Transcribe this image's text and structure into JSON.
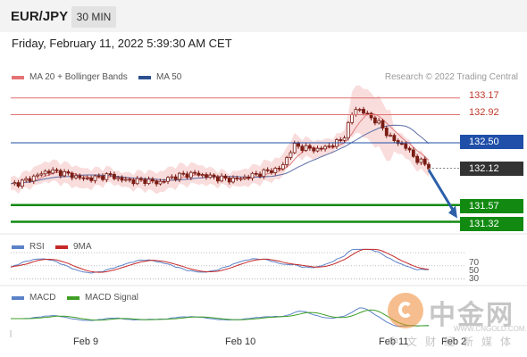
{
  "header": {
    "pair": "EUR/JPY",
    "timeframe": "30 MIN"
  },
  "datetime": "Friday, February 11, 2022 5:39:30 AM CET",
  "legend": {
    "ma20": "MA 20 + Bollinger Bands",
    "ma50": "MA 50",
    "credit": "Research © 2022 Trading Central"
  },
  "colors": {
    "up": "#7a1c14",
    "down": "#7a1c14",
    "bollinger": "#f8d5d5",
    "ma20": "#e07c7c",
    "ma50": "#5c6fa6",
    "resistance": "#e07070",
    "pivot": "#1f4fa8",
    "support": "#128a12",
    "current": "#333333",
    "arrow": "#2b5fa8",
    "rsi": "#5b82c8",
    "rsi_ma": "#c62828",
    "macd": "#5b82c8",
    "macd_signal": "#3f9f25"
  },
  "levels": {
    "r2": "133.17",
    "r1": "132.92",
    "pivot": "132.50",
    "current": "132.12",
    "s1": "131.57",
    "s2": "131.32"
  },
  "rsi": {
    "label": "RSI",
    "ma_label": "9MA",
    "ticks": [
      "70",
      "50",
      "30"
    ]
  },
  "macd": {
    "label": "MACD",
    "signal_label": "MACD Signal"
  },
  "dates": [
    "Feb 9",
    "Feb 10",
    "Feb 11",
    "Feb 2"
  ],
  "watermark": {
    "cn": "中金网",
    "url": "WWW.CNGOLD.COM.CN",
    "sub": "中文财经新媒体"
  },
  "chart_data": {
    "type": "line",
    "title": "EUR/JPY",
    "xlabel": "",
    "ylabel": "",
    "ylim": [
      131.3,
      133.3
    ],
    "x": [
      "Feb 9",
      "",
      "",
      "",
      "",
      "",
      "",
      "",
      "",
      "",
      "",
      "",
      "",
      "",
      "Feb 10",
      "",
      "",
      "",
      "",
      "",
      "",
      "",
      "",
      "",
      "",
      "",
      "",
      "",
      "Feb 11",
      "",
      "",
      "",
      ""
    ],
    "series": [
      {
        "values": [
          131.87,
          131.92,
          132.0,
          132.08,
          132.06,
          132.01,
          131.96,
          131.98,
          132.02,
          131.95,
          131.93,
          131.94,
          131.9,
          131.98,
          132.02,
          132.04,
          132.0,
          131.97,
          131.95,
          131.98,
          132.03,
          132.08,
          132.12,
          132.46,
          132.42,
          132.4,
          132.46,
          132.55,
          133.03,
          132.92,
          132.78,
          132.55,
          132.46,
          132.25,
          132.15
        ]
      }
    ]
  }
}
